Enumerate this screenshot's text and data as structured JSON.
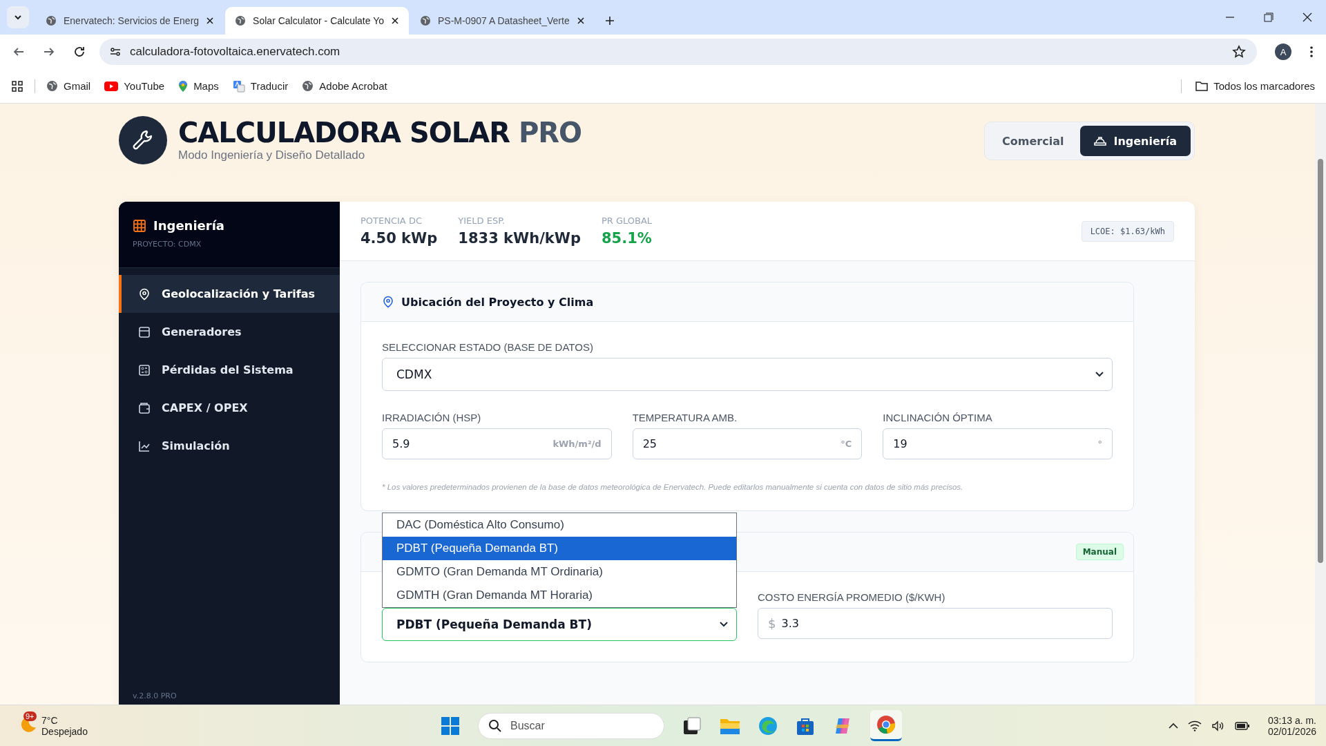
{
  "browser": {
    "tabs": [
      {
        "title": "Enervatech: Servicios de Energ",
        "selected": false
      },
      {
        "title": "Solar Calculator - Calculate Yo",
        "selected": true
      },
      {
        "title": "PS-M-0907 A Datasheet_Verte",
        "selected": false
      }
    ],
    "url": "calculadora-fotovoltaica.enervatech.com",
    "profile": "A",
    "bookmarks": [
      {
        "label": "Gmail",
        "kind": "globe"
      },
      {
        "label": "YouTube",
        "kind": "youtube"
      },
      {
        "label": "Maps",
        "kind": "maps"
      },
      {
        "label": "Traducir",
        "kind": "translate"
      },
      {
        "label": "Adobe Acrobat",
        "kind": "globe"
      }
    ],
    "bookmarks_folder": "Todos los marcadores"
  },
  "app": {
    "title": "CALCULADORA SOLAR",
    "title_suffix": "PRO",
    "subtitle": "Modo Ingeniería y Diseño Detallado",
    "modes": [
      {
        "label": "Comercial",
        "selected": false
      },
      {
        "label": "Ingeniería",
        "selected": true
      }
    ]
  },
  "sidebar": {
    "title": "Ingeniería",
    "project": "PROYECTO: CDMX",
    "items": [
      {
        "label": "Geolocalización y Tarifas",
        "kind": "pin",
        "selected": true
      },
      {
        "label": "Generadores",
        "kind": "panel",
        "selected": false
      },
      {
        "label": "Pérdidas del Sistema",
        "kind": "gauge",
        "selected": false
      },
      {
        "label": "CAPEX / OPEX",
        "kind": "wallet",
        "selected": false
      },
      {
        "label": "Simulación",
        "kind": "chart",
        "selected": false
      }
    ],
    "version": "v.2.8.0 PRO"
  },
  "stats": [
    {
      "label": "POTENCIA DC",
      "value": "4.50 kWp",
      "highlight": false
    },
    {
      "label": "YIELD ESP.",
      "value": "1833 kWh/kWp",
      "highlight": false
    },
    {
      "label": "PR GLOBAL",
      "value": "85.1%",
      "highlight": true
    }
  ],
  "lcoe": "LCOE: $1.63/kWh",
  "location_section": {
    "title": "Ubicación del Proyecto y Clima",
    "state_select": {
      "label": "SELECCIONAR ESTADO (BASE DE DATOS)",
      "value": "CDMX"
    },
    "fields": [
      {
        "label": "IRRADIACIÓN (HSP)",
        "value": "5.9",
        "unit": "kWh/m²/d"
      },
      {
        "label": "TEMPERATURA AMB.",
        "value": "25",
        "unit": "°C"
      },
      {
        "label": "INCLINACIÓN ÓPTIMA",
        "value": "19",
        "unit": "°"
      }
    ],
    "note": "* Los valores predeterminados provienen de la base de datos meteorológica de Enervatech. Puede editarlos manualmente si cuenta con datos de sitio más precisos."
  },
  "tariff_section": {
    "badge": "Manual",
    "tariff_select": {
      "value": "PDBT (Pequeña Demanda BT)"
    },
    "dropdown": [
      {
        "label": "DAC (Doméstica Alto Consumo)",
        "selected": false
      },
      {
        "label": "PDBT (Pequeña Demanda BT)",
        "selected": true
      },
      {
        "label": "GDMTO (Gran Demanda MT Ordinaria)",
        "selected": false
      },
      {
        "label": "GDMTH (Gran Demanda MT Horaria)",
        "selected": false
      }
    ],
    "cost_field": {
      "label": "COSTO ENERGÍA PROMEDIO ($/KWH)",
      "prefix": "$",
      "value": "3.3"
    }
  },
  "taskbar": {
    "weather": {
      "badge": "9+",
      "temperature": "7°C",
      "condition": "Despejado"
    },
    "search": {
      "placeholder": "Buscar"
    },
    "time": "03:13 a. m.",
    "date": "02/01/2026"
  }
}
